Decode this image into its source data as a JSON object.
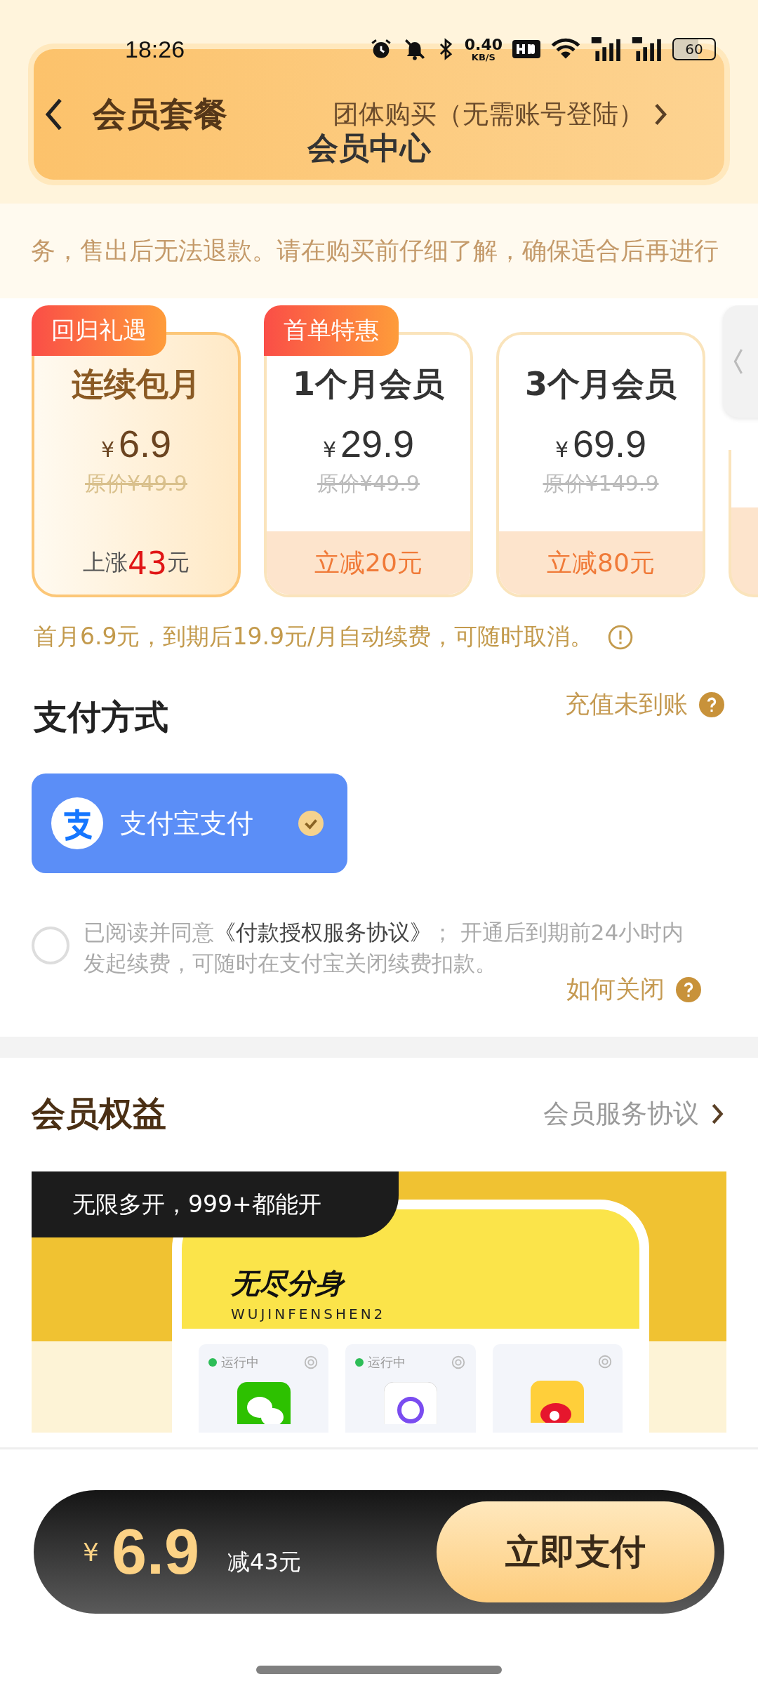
{
  "status_bar": {
    "time": "18:26",
    "speed": "0.40",
    "speed_unit": "KB/S",
    "battery": "60"
  },
  "header": {
    "tab": "会员套餐",
    "group_buy": "团体购买（无需账号登陆）",
    "title": "会员中心"
  },
  "notice": "务，售出后无法退款。请在购买前仔细了解，确保适合后再进行",
  "plans": [
    {
      "kind": "increase",
      "badge": "回归礼遇",
      "name": "连续包月",
      "currency": "¥",
      "price": "6.9",
      "original": "原价¥49.9",
      "footer_prefix": "上涨",
      "footer_amount": "43",
      "footer_suffix": "元",
      "selected": true
    },
    {
      "kind": "discount",
      "badge": "首单特惠",
      "name": "1个月会员",
      "currency": "¥",
      "price": "29.9",
      "original": "原价¥49.9",
      "footer": "立减20元",
      "selected": false
    },
    {
      "kind": "discount",
      "name": "3个月会员",
      "currency": "¥",
      "price": "69.9",
      "original": "原价¥149.9",
      "footer": "立减80元",
      "selected": false
    }
  ],
  "renewal_note": "首月6.9元，到期后19.9元/月自动续费，可随时取消。",
  "payment": {
    "title": "支付方式",
    "help": "充值未到账",
    "methods": [
      {
        "label": "支付宝支付",
        "selected": true
      }
    ]
  },
  "agreement": {
    "checked": false,
    "prefix": "已阅读并同意",
    "link": "《付款授权服务协议》",
    "suffix": "； 开通后到期前24小时内发起续费，可随时在支付宝关闭续费扣款。",
    "help": "如何关闭"
  },
  "benefits": {
    "title": "会员权益",
    "link": "会员服务协议",
    "banner": {
      "tag": "无限多开，999+都能开",
      "app_name": "无尽分身",
      "app_sub": "WUJINFENSHEN2",
      "tiles": [
        {
          "running": true,
          "status": "运行中"
        },
        {
          "running": true,
          "status": "运行中"
        },
        {
          "running": false
        }
      ]
    }
  },
  "checkout": {
    "currency": "¥",
    "price": "6.9",
    "saving": "减43元",
    "button": "立即支付"
  }
}
